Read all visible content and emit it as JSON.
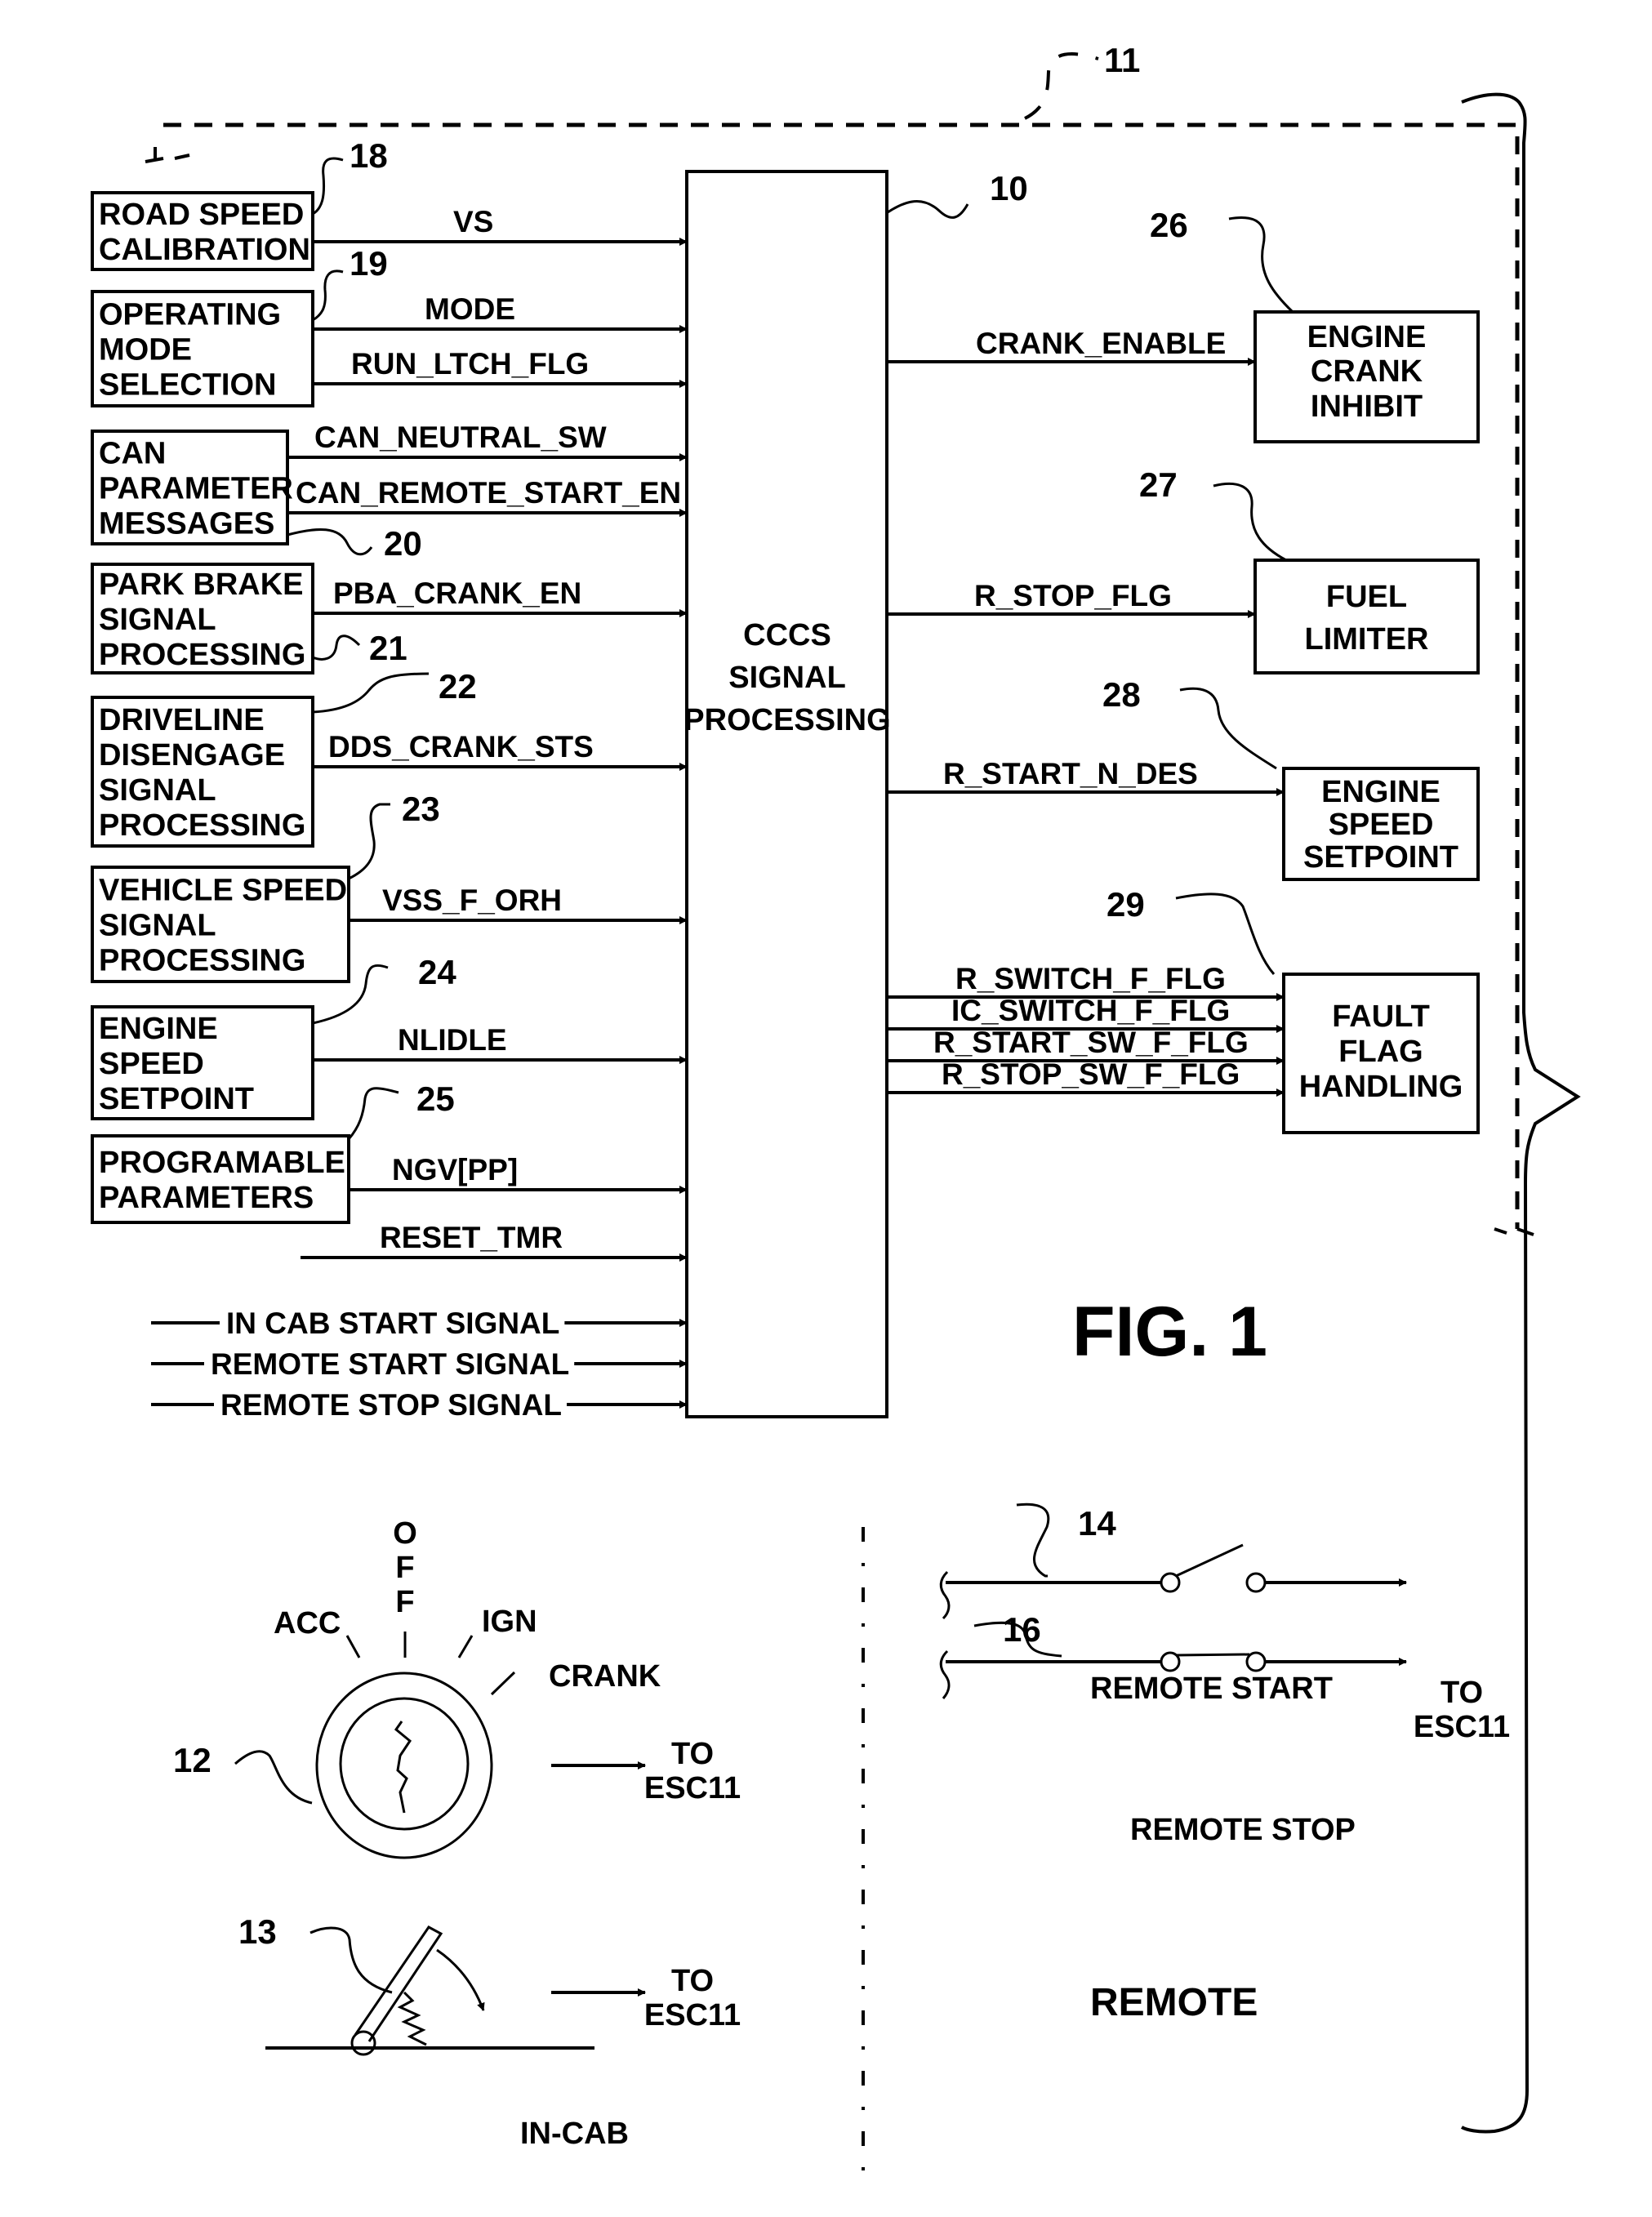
{
  "figure": {
    "title": "FIG. 1",
    "system_ref": "11",
    "processor": {
      "ref": "10",
      "lines": [
        "CCCS",
        "SIGNAL",
        "PROCESSING"
      ]
    },
    "inputs": [
      {
        "ref": "18",
        "lines": [
          "ROAD SPEED",
          "CALIBRATION"
        ],
        "signals": [
          "VS"
        ]
      },
      {
        "ref": "19",
        "lines": [
          "OPERATING",
          "MODE",
          "SELECTION"
        ],
        "signals": [
          "MODE",
          "RUN_LTCH_FLG"
        ]
      },
      {
        "ref": "20",
        "lines": [
          "CAN",
          "PARAMETER",
          "MESSAGES"
        ],
        "signals": [
          "CAN_NEUTRAL_SW",
          "CAN_REMOTE_START_EN"
        ]
      },
      {
        "ref": "21",
        "lines": [
          "PARK BRAKE",
          "SIGNAL",
          "PROCESSING"
        ],
        "signals": [
          "PBA_CRANK_EN"
        ]
      },
      {
        "ref": "22",
        "lines": [
          "DRIVELINE",
          "DISENGAGE",
          "SIGNAL",
          "PROCESSING"
        ],
        "signals": [
          "DDS_CRANK_STS"
        ]
      },
      {
        "ref": "23",
        "lines": [
          "VEHICLE SPEED",
          "SIGNAL",
          "PROCESSING"
        ],
        "signals": [
          "VSS_F_ORH"
        ]
      },
      {
        "ref": "24",
        "lines": [
          "ENGINE",
          "SPEED",
          "SETPOINT"
        ],
        "signals": [
          "NLIDLE"
        ]
      },
      {
        "ref": "25",
        "lines": [
          "PROGRAMABLE",
          "PARAMETERS"
        ],
        "signals": [
          "NGV[PP]"
        ]
      }
    ],
    "free_inputs": [
      "RESET_TMR",
      "IN CAB START SIGNAL",
      "REMOTE START SIGNAL",
      "REMOTE STOP SIGNAL"
    ],
    "outputs": [
      {
        "ref": "26",
        "lines": [
          "ENGINE",
          "CRANK",
          "INHIBIT"
        ],
        "signals": [
          "CRANK_ENABLE"
        ]
      },
      {
        "ref": "27",
        "lines": [
          "FUEL",
          "LIMITER"
        ],
        "signals": [
          "R_STOP_FLG"
        ]
      },
      {
        "ref": "28",
        "lines": [
          "ENGINE",
          "SPEED",
          "SETPOINT"
        ],
        "signals": [
          "R_START_N_DES"
        ]
      },
      {
        "ref": "29",
        "lines": [
          "FAULT",
          "FLAG",
          "HANDLING"
        ],
        "signals": [
          "R_SWITCH_F_FLG",
          "IC_SWITCH_F_FLG",
          "R_START_SW_F_FLG",
          "R_STOP_SW_F_FLG"
        ]
      }
    ],
    "in_cab": {
      "section_label": "IN-CAB",
      "ignition": {
        "ref": "12",
        "positions": [
          "ACC",
          "OFF",
          "IGN",
          "CRANK"
        ],
        "dest": [
          "TO",
          "ESC11"
        ]
      },
      "pedal": {
        "ref": "13",
        "dest": [
          "TO",
          "ESC11"
        ]
      }
    },
    "remote": {
      "section_label": "REMOTE",
      "start_switch": {
        "ref": "14",
        "label": "REMOTE START"
      },
      "stop_switch": {
        "ref": "16",
        "label": "REMOTE STOP"
      },
      "dest": [
        "TO",
        "ESC11"
      ]
    }
  }
}
